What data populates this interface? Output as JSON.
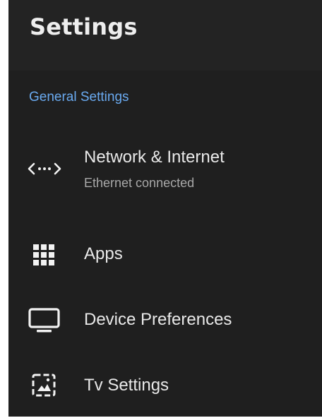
{
  "header": {
    "title": "Settings"
  },
  "section": {
    "label": "General Settings"
  },
  "items": [
    {
      "label": "Network & Internet",
      "sub": "Ethernet connected",
      "icon": "network-icon"
    },
    {
      "label": "Apps",
      "icon": "apps-grid-icon"
    },
    {
      "label": "Device Preferences",
      "icon": "tv-monitor-icon"
    },
    {
      "label": "Tv Settings",
      "icon": "tv-input-icon"
    }
  ],
  "colors": {
    "background": "#1f1f1f",
    "header_background": "#232323",
    "accent": "#6aaaf0",
    "text_primary": "#e9e9e9",
    "text_secondary": "#a8a8a8"
  }
}
